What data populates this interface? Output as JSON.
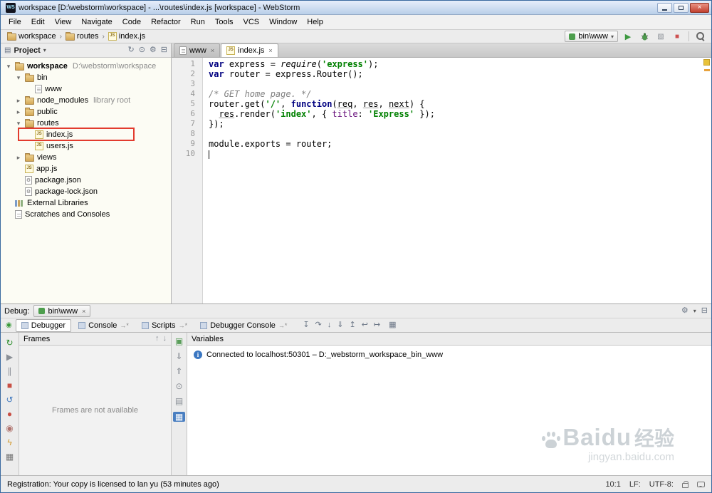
{
  "window": {
    "title": "workspace [D:\\webstorm\\workspace] - ...\\routes\\index.js [workspace] - WebStorm",
    "app_badge": "WS"
  },
  "menu": {
    "items": [
      "File",
      "Edit",
      "View",
      "Navigate",
      "Code",
      "Refactor",
      "Run",
      "Tools",
      "VCS",
      "Window",
      "Help"
    ]
  },
  "toolbar": {
    "breadcrumbs": [
      {
        "label": "workspace",
        "icon": "folder"
      },
      {
        "label": "routes",
        "icon": "folder"
      },
      {
        "label": "index.js",
        "icon": "js"
      }
    ],
    "run_config": "bin\\www"
  },
  "project": {
    "header": "Project",
    "tree": [
      {
        "label": "workspace",
        "detail": "D:\\webstorm\\workspace",
        "level": 0,
        "icon": "folder",
        "chevron": "down",
        "bold": true
      },
      {
        "label": "bin",
        "level": 1,
        "icon": "folder",
        "chevron": "down"
      },
      {
        "label": "www",
        "level": 2,
        "icon": "file"
      },
      {
        "label": "node_modules",
        "detail": "library root",
        "level": 1,
        "icon": "folder",
        "chevron": "right"
      },
      {
        "label": "public",
        "level": 1,
        "icon": "folder",
        "chevron": "right"
      },
      {
        "label": "routes",
        "level": 1,
        "icon": "folder",
        "chevron": "down"
      },
      {
        "label": "index.js",
        "level": 2,
        "icon": "js",
        "highlighted": true
      },
      {
        "label": "users.js",
        "level": 2,
        "icon": "js"
      },
      {
        "label": "views",
        "level": 1,
        "icon": "folder",
        "chevron": "right"
      },
      {
        "label": "app.js",
        "level": 1,
        "icon": "js"
      },
      {
        "label": "package.json",
        "level": 1,
        "icon": "json"
      },
      {
        "label": "package-lock.json",
        "level": 1,
        "icon": "json"
      },
      {
        "label": "External Libraries",
        "level": 0,
        "icon": "libs"
      },
      {
        "label": "Scratches and Consoles",
        "level": 0,
        "icon": "scratch"
      }
    ]
  },
  "editor": {
    "tabs": [
      {
        "label": "www",
        "icon": "file",
        "active": false
      },
      {
        "label": "index.js",
        "icon": "js",
        "active": true
      }
    ],
    "lines": [
      {
        "no": "1",
        "tokens": [
          [
            "kw",
            "var"
          ],
          [
            "pl",
            " express = "
          ],
          [
            "fn",
            "require"
          ],
          [
            "pl",
            "("
          ],
          [
            "str",
            "'express'"
          ],
          [
            "pl",
            ");"
          ]
        ]
      },
      {
        "no": "2",
        "tokens": [
          [
            "kw",
            "var"
          ],
          [
            "pl",
            " router = express.Router();"
          ]
        ]
      },
      {
        "no": "3",
        "tokens": []
      },
      {
        "no": "4",
        "tokens": [
          [
            "cmt",
            "/* GET home page. */"
          ]
        ]
      },
      {
        "no": "5",
        "tokens": [
          [
            "pl",
            "router.get("
          ],
          [
            "str",
            "'/'"
          ],
          [
            "pl",
            ", "
          ],
          [
            "kw",
            "function"
          ],
          [
            "pl",
            "("
          ],
          [
            "param",
            "req"
          ],
          [
            "pl",
            ", "
          ],
          [
            "param",
            "res"
          ],
          [
            "pl",
            ", "
          ],
          [
            "param",
            "next"
          ],
          [
            "pl",
            ") {"
          ]
        ]
      },
      {
        "no": "6",
        "tokens": [
          [
            "pl",
            "  "
          ],
          [
            "param",
            "res"
          ],
          [
            "pl",
            ".render("
          ],
          [
            "str",
            "'index'"
          ],
          [
            "pl",
            ", { "
          ],
          [
            "field",
            "title"
          ],
          [
            "pl",
            ": "
          ],
          [
            "str",
            "'Express'"
          ],
          [
            "pl",
            " });"
          ]
        ]
      },
      {
        "no": "7",
        "tokens": [
          [
            "pl",
            "});"
          ]
        ]
      },
      {
        "no": "8",
        "tokens": []
      },
      {
        "no": "9",
        "tokens": [
          [
            "pl",
            "module.exports = router;"
          ]
        ]
      },
      {
        "no": "10",
        "tokens": [],
        "caret": true
      }
    ]
  },
  "debug": {
    "label": "Debug:",
    "session_tab": "bin\\www",
    "tabs": [
      {
        "label": "Debugger",
        "active": true
      },
      {
        "label": "Console",
        "suffix": "→*"
      },
      {
        "label": "Scripts",
        "suffix": "→*"
      },
      {
        "label": "Debugger Console",
        "suffix": "→*"
      }
    ],
    "step_toolbar": [
      "show-execution-point",
      "step-over",
      "step-into",
      "force-step-into",
      "step-out",
      "drop-frame",
      "run-to-cursor"
    ],
    "left_toolbar": [
      "rerun",
      "resume",
      "pause",
      "stop",
      "refresh",
      "view-breakpoints",
      "mute-breakpoints",
      "evaluate",
      "layout"
    ],
    "side_toolbar": [
      "debug-views",
      "scroll-down",
      "scroll-up",
      "pin-tab",
      "snapshot",
      "layout-grid"
    ],
    "frames": {
      "header": "Frames",
      "empty_text": "Frames are not available"
    },
    "variables": {
      "header": "Variables",
      "message": "Connected to localhost:50301 – D:_webstorm_workspace_bin_www"
    }
  },
  "status": {
    "left": "Registration: Your copy is licensed to lan yu (53 minutes ago)",
    "caret_pos": "10:1",
    "line_ending": "LF:",
    "encoding": "UTF-8:"
  },
  "watermark": {
    "brand": "Baidu",
    "brand_cn": "经验",
    "url": "jingyan.baidu.com"
  }
}
